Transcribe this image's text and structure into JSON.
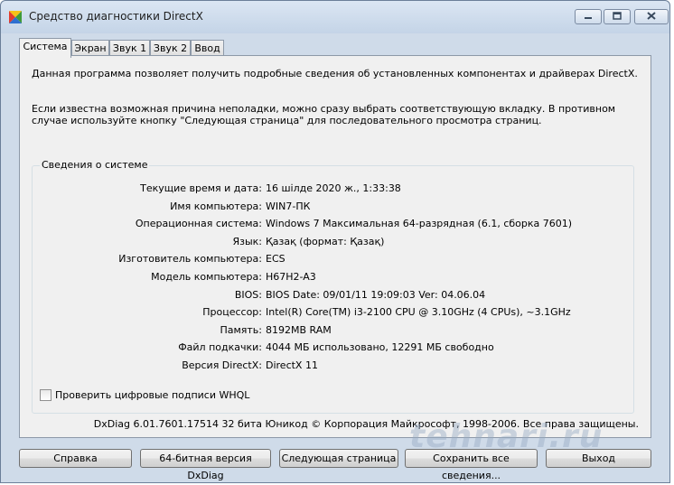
{
  "window": {
    "title": "Средство диагностики DirectX",
    "app_icon": "directx-icon",
    "controls": [
      "minimize-icon",
      "maximize-icon",
      "close-icon"
    ]
  },
  "tabs": [
    {
      "label": "Система",
      "active": true
    },
    {
      "label": "Экран",
      "active": false
    },
    {
      "label": "Звук 1",
      "active": false
    },
    {
      "label": "Звук 2",
      "active": false
    },
    {
      "label": "Ввод",
      "active": false
    }
  ],
  "intro": {
    "line1": "Данная программа позволяет получить подробные сведения об установленных компонентах и драйверах DirectX.",
    "line2": "Если известна возможная причина неполадки, можно сразу выбрать соответствующую вкладку. В противном случае используйте кнопку \"Следующая страница\" для последовательного просмотра страниц."
  },
  "system_info": {
    "group_title": "Сведения о системе",
    "rows": [
      {
        "label": "Текущие время и дата:",
        "value": "16 шілде 2020 ж., 1:33:38"
      },
      {
        "label": "Имя компьютера:",
        "value": "WIN7-ПК"
      },
      {
        "label": "Операционная система:",
        "value": "Windows 7 Максимальная 64-разрядная (6.1, сборка 7601)"
      },
      {
        "label": "Язык:",
        "value": "Қазақ (формат: Қазақ)"
      },
      {
        "label": "Изготовитель компьютера:",
        "value": "ECS"
      },
      {
        "label": "Модель компьютера:",
        "value": "H67H2-A3"
      },
      {
        "label": "BIOS:",
        "value": "BIOS Date: 09/01/11 19:09:03 Ver: 04.06.04"
      },
      {
        "label": "Процессор:",
        "value": "Intel(R) Core(TM) i3-2100 CPU @ 3.10GHz (4 CPUs), ~3.1GHz"
      },
      {
        "label": "Память:",
        "value": "8192MB RAM"
      },
      {
        "label": "Файл подкачки:",
        "value": "4044 МБ использовано, 12291 МБ свободно"
      },
      {
        "label": "Версия DirectX:",
        "value": "DirectX 11"
      }
    ]
  },
  "whql_checkbox": {
    "label": "Проверить цифровые подписи WHQL",
    "checked": false
  },
  "footer": "DxDiag 6.01.7601.17514 32 бита Юникод  © Корпорация Майкрософт, 1998-2006.  Все права защищены.",
  "buttons": {
    "help": "Справка",
    "dxdiag64": "64-битная версия DxDiag",
    "next": "Следующая страница",
    "save": "Сохранить все сведения...",
    "exit": "Выход"
  },
  "watermark": "tehnari.ru"
}
